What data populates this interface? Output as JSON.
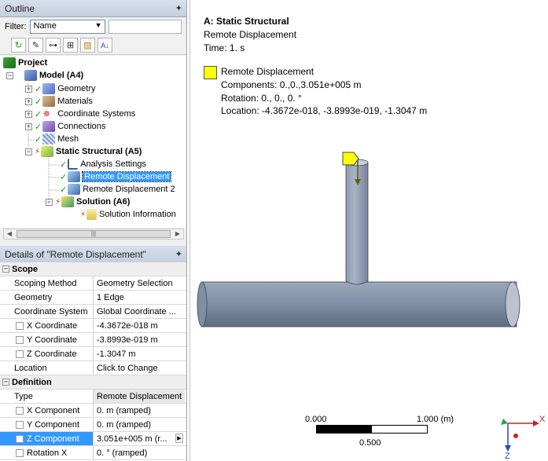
{
  "outline": {
    "title": "Outline",
    "filter_label": "Filter:",
    "filter_value": "Name",
    "tree": [
      {
        "label": "Project"
      },
      {
        "label": "Model (A4)"
      },
      {
        "label": "Geometry"
      },
      {
        "label": "Materials"
      },
      {
        "label": "Coordinate Systems"
      },
      {
        "label": "Connections"
      },
      {
        "label": "Mesh"
      },
      {
        "label": "Static Structural (A5)"
      },
      {
        "label": "Analysis Settings"
      },
      {
        "label": "Remote Displacement"
      },
      {
        "label": "Remote Displacement 2"
      },
      {
        "label": "Solution (A6)"
      },
      {
        "label": "Solution Information"
      }
    ]
  },
  "details": {
    "title": "Details of \"Remote Displacement\"",
    "sections": [
      {
        "name": "Scope",
        "rows": [
          {
            "label": "Scoping Method",
            "value": "Geometry Selection"
          },
          {
            "label": "Geometry",
            "value": "1 Edge"
          },
          {
            "label": "Coordinate System",
            "value": "Global Coordinate ..."
          },
          {
            "label": "X Coordinate",
            "value": "-4.3672e-018 m"
          },
          {
            "label": "Y Coordinate",
            "value": "-3.8993e-019 m"
          },
          {
            "label": "Z Coordinate",
            "value": "-1.3047 m"
          },
          {
            "label": "Location",
            "value": "Click to Change"
          }
        ]
      },
      {
        "name": "Definition",
        "rows": [
          {
            "label": "Type",
            "value": "Remote Displacement"
          },
          {
            "label": "X Component",
            "value": "0. m  (ramped)"
          },
          {
            "label": "Y Component",
            "value": "0. m  (ramped)"
          },
          {
            "label": "Z Component",
            "value": "3.051e+005 m  (r..."
          },
          {
            "label": "Rotation X",
            "value": "0. °  (ramped)"
          }
        ]
      }
    ]
  },
  "viewport": {
    "analysis_title": "A: Static Structural",
    "object_name": "Remote Displacement",
    "time": "Time: 1. s",
    "legend": {
      "label": "Remote Displacement",
      "components": "Components: 0.,0.,3.051e+005 m",
      "rotation": "Rotation: 0., 0., 0. °",
      "location": "Location: -4.3672e-018, -3.8993e-019, -1.3047 m",
      "color": "#ffff00"
    },
    "scale": {
      "start": "0.000",
      "end": "1.000 (m)",
      "mid": "0.500"
    },
    "triad": {
      "x": "X",
      "z": "Z"
    }
  },
  "colors": {
    "selection": "#3399ff",
    "pipe": "#7f8fa3",
    "tree_check": "#119911"
  }
}
